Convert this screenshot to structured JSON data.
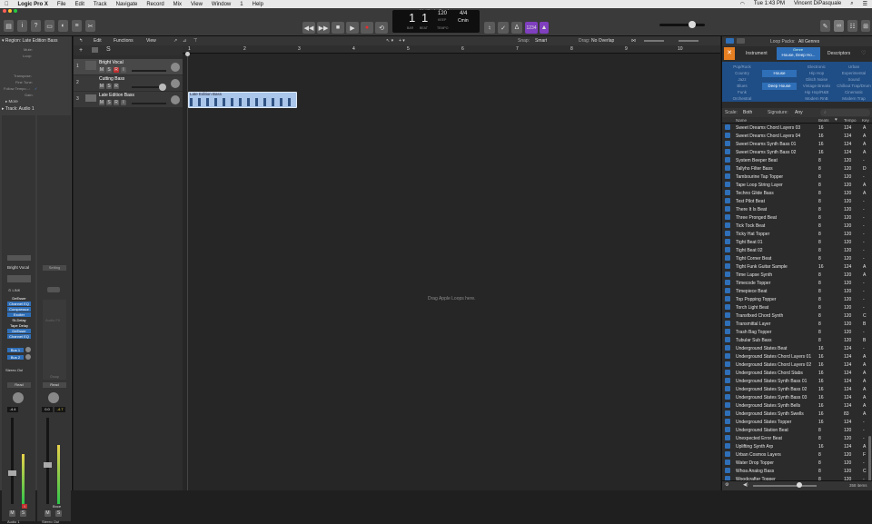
{
  "menubar": {
    "items": [
      "Logic Pro X",
      "File",
      "Edit",
      "Track",
      "Navigate",
      "Record",
      "Mix",
      "View",
      "Window",
      "1",
      "Help"
    ],
    "clock": "Tue 1:43 PM",
    "user": "Vincent DiPasquale"
  },
  "window": {
    "title": "Untitled - Tracks"
  },
  "lcd": {
    "bar": "1",
    "beat": "1",
    "bar_label": "BAR",
    "beat_label": "BEAT",
    "tempo": "120",
    "tempo_label": "KEEP",
    "tempo_sub": "TEMPO",
    "signature": "4/4",
    "key": "Cmin",
    "cpu": "1234"
  },
  "inspector": {
    "region_label": "Region:",
    "region_name": "Late Edition Bass",
    "params": [
      "Mute:",
      "Loop:",
      "Transpose:",
      "Fine Tune:",
      "Follow Tempo...:",
      "Gain:"
    ],
    "more": "More",
    "track_label": "Track:",
    "track_name": "Audio 1",
    "strip1_name": "Bright Vocal",
    "strip2_setting": "Setting",
    "link": "LINK",
    "plugins": [
      "DeEsser",
      "Channel EQ",
      "Compressor",
      "Exciter",
      "St-Delay",
      "Tape Delay",
      "DeEsser",
      "Channel EQ"
    ],
    "audio_fx": "Audio FX",
    "bus1": "Bus 1",
    "bus2": "Bus 2",
    "stereo_out": "Stereo Out",
    "group": "Group",
    "read1": "Read",
    "read2": "Read",
    "vol1": "-4.4",
    "vol2a": "0.0",
    "vol2b": "-4.7",
    "bnce": "Bnce",
    "ch1_name": "Audio 1",
    "ch2_name": "Stereo Out",
    "m": "M",
    "s": "S"
  },
  "track_menus": {
    "edit": "Edit",
    "functions": "Functions",
    "view": "View"
  },
  "tracks": [
    {
      "num": "1",
      "name": "Bright Vocal"
    },
    {
      "num": "2",
      "name": "Cutting Bass"
    },
    {
      "num": "3",
      "name": "Late Edition Bass"
    }
  ],
  "track_btns": {
    "m": "M",
    "s": "S",
    "r": "R",
    "i": "I"
  },
  "arrange": {
    "snap_label": "Snap:",
    "snap_value": "Smart",
    "drag_label": "Drag:",
    "drag_value": "No Overlap",
    "ruler": [
      "1",
      "2",
      "3",
      "4",
      "5",
      "6",
      "7",
      "8",
      "9",
      "10"
    ],
    "region_name": "Late Edition Bass",
    "drop_hint": "Drag Apple Loops here."
  },
  "loops": {
    "packs_label": "Loop Packs:",
    "packs_value": "All Genres",
    "tab_instrument": "Instrument",
    "tab_genre": "Genre",
    "tab_genre_value": "House, Deep Ho...",
    "tab_descriptors": "Descriptors",
    "genre_left": [
      "Pop/Rock",
      "Country",
      "Jazz",
      "Blues",
      "Funk",
      "Orchestral",
      "World"
    ],
    "genre_mid": [
      "House",
      "Deep House"
    ],
    "genre_right": [
      "Electronic",
      "Hip Hop",
      "Glitch Noise",
      "Vintage Breaks",
      "Hip Hop/R&B",
      "Modern RnB"
    ],
    "genre_far": [
      "Urban",
      "Experimental",
      "Sound",
      "Chillout Trap/Drum",
      "Cinematic",
      "Modern Trap"
    ],
    "scale_label": "Scale:",
    "scale_value": "Both",
    "signature_label": "Signature:",
    "signature_value": "Any",
    "columns": {
      "name": "Name",
      "beats": "Beats",
      "tempo": "Tempo",
      "key": "Key"
    },
    "rows": [
      [
        "Sweet Dreams Chord Layers 03",
        "16",
        "124",
        "A"
      ],
      [
        "Sweet Dreams Chord Layers 04",
        "16",
        "124",
        "A"
      ],
      [
        "Sweet Dreams Synth Bass 01",
        "16",
        "124",
        "A"
      ],
      [
        "Sweet Dreams Synth Bass 02",
        "16",
        "124",
        "A"
      ],
      [
        "System Beeper Beat",
        "8",
        "120",
        "-"
      ],
      [
        "Tallyho Filter Bass",
        "8",
        "120",
        "D"
      ],
      [
        "Tambourine Tap Topper",
        "8",
        "120",
        "-"
      ],
      [
        "Tape Loop String Layer",
        "8",
        "120",
        "A"
      ],
      [
        "Techno Glide Bass",
        "8",
        "120",
        "A"
      ],
      [
        "Test Pilot Beat",
        "8",
        "120",
        "-"
      ],
      [
        "There It Is Beat",
        "8",
        "120",
        "-"
      ],
      [
        "Three Pronged Beat",
        "8",
        "120",
        "-"
      ],
      [
        "Tick Tock Beat",
        "8",
        "120",
        "-"
      ],
      [
        "Ticky Hat Topper",
        "8",
        "120",
        "-"
      ],
      [
        "Tight Beat 01",
        "8",
        "120",
        "-"
      ],
      [
        "Tight Beat 02",
        "8",
        "120",
        "-"
      ],
      [
        "Tight Corner Beat",
        "8",
        "120",
        "-"
      ],
      [
        "Tight Funk Guitar Sample",
        "16",
        "124",
        "A"
      ],
      [
        "Time Lapse Synth",
        "8",
        "120",
        "A"
      ],
      [
        "Timecode Topper",
        "8",
        "120",
        "-"
      ],
      [
        "Timepiece Beat",
        "8",
        "120",
        "-"
      ],
      [
        "Top Popping Topper",
        "8",
        "120",
        "-"
      ],
      [
        "Torch Light Beat",
        "8",
        "120",
        "-"
      ],
      [
        "Transfixed Chord Synth",
        "8",
        "120",
        "C"
      ],
      [
        "Transmittal Layer",
        "8",
        "120",
        "B"
      ],
      [
        "Trash Bag Topper",
        "8",
        "120",
        "-"
      ],
      [
        "Tubular Sub Bass",
        "8",
        "120",
        "B"
      ],
      [
        "Underground States Beat",
        "16",
        "124",
        "-"
      ],
      [
        "Underground States Chord Layers 01",
        "16",
        "124",
        "A"
      ],
      [
        "Underground States Chord Layers 02",
        "16",
        "124",
        "A"
      ],
      [
        "Underground States Chord Stabs",
        "16",
        "124",
        "A"
      ],
      [
        "Underground States Synth Bass 01",
        "16",
        "124",
        "A"
      ],
      [
        "Underground States Synth Bass 02",
        "16",
        "124",
        "A"
      ],
      [
        "Underground States Synth Bass 03",
        "16",
        "124",
        "A"
      ],
      [
        "Underground States Synth Bells",
        "16",
        "124",
        "A"
      ],
      [
        "Underground States Synth Swells",
        "16",
        "83",
        "A"
      ],
      [
        "Underground States Topper",
        "16",
        "124",
        "-"
      ],
      [
        "Underground Station Beat",
        "8",
        "120",
        "-"
      ],
      [
        "Unexpected Error Beat",
        "8",
        "120",
        "-"
      ],
      [
        "Uplifting Synth Arp",
        "16",
        "124",
        "A"
      ],
      [
        "Urban Cosmos Layers",
        "8",
        "120",
        "F"
      ],
      [
        "Water Drop Topper",
        "8",
        "120",
        "-"
      ],
      [
        "Whoa Analog Bass",
        "8",
        "120",
        "C"
      ],
      [
        "Woodcrafter Topper",
        "8",
        "120",
        "-"
      ]
    ],
    "count": "358 items"
  },
  "colors": {
    "accent": "#2f6fb8",
    "region": "#aac6ea",
    "cpu_badge": "#7f3fbf"
  }
}
